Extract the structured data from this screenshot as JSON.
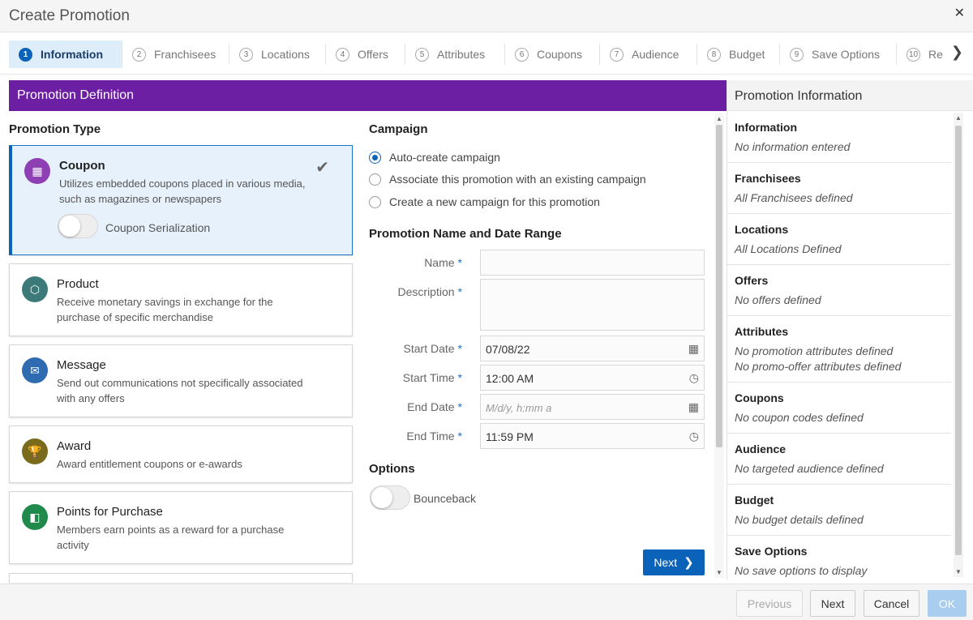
{
  "window": {
    "title": "Create Promotion",
    "close_glyph": "✕",
    "close_icon": "close-icon"
  },
  "stepper": {
    "steps": [
      {
        "num": "1",
        "label": "Information",
        "active": true
      },
      {
        "num": "2",
        "label": "Franchisees"
      },
      {
        "num": "3",
        "label": "Locations"
      },
      {
        "num": "4",
        "label": "Offers"
      },
      {
        "num": "5",
        "label": "Attributes"
      },
      {
        "num": "6",
        "label": "Coupons"
      },
      {
        "num": "7",
        "label": "Audience"
      },
      {
        "num": "8",
        "label": "Budget"
      },
      {
        "num": "9",
        "label": "Save Options"
      },
      {
        "num": "10",
        "label": "Re"
      }
    ],
    "next_glyph": "❯"
  },
  "definition": {
    "header": "Promotion Definition"
  },
  "promotion_type": {
    "title": "Promotion Type",
    "cards": [
      {
        "title": "Coupon",
        "desc": "Utilizes embedded coupons placed in various media, such as magazines or newspapers",
        "color": "#8e3fb4",
        "icon": "coupon-icon",
        "glyph": "▦",
        "selected": true,
        "toggle_label": "Coupon Serialization"
      },
      {
        "title": "Product",
        "desc": "Receive monetary savings in exchange for the purchase of specific merchandise",
        "color": "#3b7a78",
        "icon": "product-box-icon",
        "glyph": "⬡"
      },
      {
        "title": "Message",
        "desc": "Send out communications not specifically associated with any offers",
        "color": "#2e6bb0",
        "icon": "envelope-icon",
        "glyph": "✉"
      },
      {
        "title": "Award",
        "desc": "Award entitlement coupons or e-awards",
        "color": "#7a6a1c",
        "icon": "trophy-icon",
        "glyph": "🏆"
      },
      {
        "title": "Points for Purchase",
        "desc": "Members earn points as a reward for a purchase activity",
        "color": "#1f8a4c",
        "icon": "points-icon",
        "glyph": "◧"
      }
    ],
    "check_glyph": "✔"
  },
  "campaign": {
    "title": "Campaign",
    "options": [
      {
        "label": "Auto-create campaign",
        "checked": true
      },
      {
        "label": "Associate this promotion with an existing campaign"
      },
      {
        "label": "Create a new campaign for this promotion"
      }
    ]
  },
  "name_date": {
    "title": "Promotion Name and Date Range",
    "required_mark": "*",
    "name_label": "Name",
    "name_value": "",
    "description_label": "Description",
    "description_value": "",
    "start_date_label": "Start Date",
    "start_date_value": "07/08/22",
    "start_time_label": "Start Time",
    "start_time_value": "12:00 AM",
    "end_date_label": "End Date",
    "end_date_placeholder": "M/d/y, h:mm a",
    "end_time_label": "End Time",
    "end_time_value": "11:59 PM",
    "calendar_glyph": "▦",
    "clock_glyph": "◷"
  },
  "options": {
    "title": "Options",
    "bounceback_label": "Bounceback"
  },
  "inner_next": {
    "label": "Next",
    "chevron": "❯"
  },
  "info_panel": {
    "title": "Promotion Information",
    "sections": [
      {
        "title": "Information",
        "values": [
          "No information entered"
        ]
      },
      {
        "title": "Franchisees",
        "values": [
          "All Franchisees defined"
        ]
      },
      {
        "title": "Locations",
        "values": [
          "All Locations Defined"
        ]
      },
      {
        "title": "Offers",
        "values": [
          "No offers defined"
        ]
      },
      {
        "title": "Attributes",
        "values": [
          "No promotion attributes defined",
          "No promo-offer attributes defined"
        ]
      },
      {
        "title": "Coupons",
        "values": [
          "No coupon codes defined"
        ]
      },
      {
        "title": "Audience",
        "values": [
          "No targeted audience defined"
        ]
      },
      {
        "title": "Budget",
        "values": [
          "No budget details defined"
        ]
      },
      {
        "title": "Save Options",
        "values": [
          "No save options to display"
        ]
      }
    ]
  },
  "footer": {
    "previous": "Previous",
    "next": "Next",
    "cancel": "Cancel",
    "ok": "OK"
  },
  "scroll": {
    "up_glyph": "▲",
    "down_glyph": "▼"
  }
}
